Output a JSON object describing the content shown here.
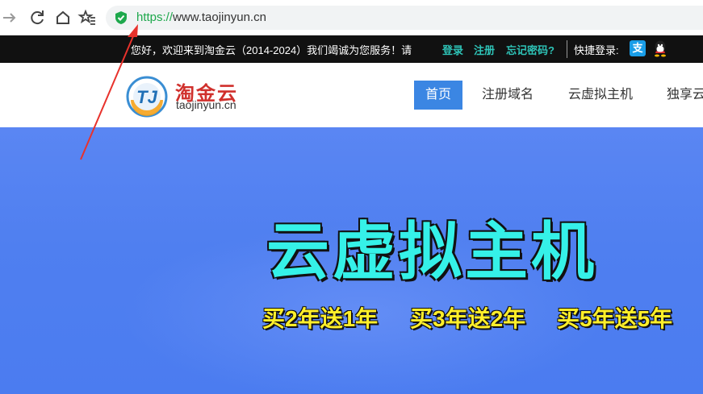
{
  "browser": {
    "url_scheme": "https://",
    "url_host": "www.taojinyun.cn",
    "icons": [
      "forward-icon",
      "reload-icon",
      "home-icon",
      "bookmark-star-icon",
      "secure-shield-icon"
    ]
  },
  "topbar": {
    "welcome": "您好，欢迎来到淘金云（2014-2024）我们竭诚为您服务！请",
    "login": "登录",
    "register": "注册",
    "forgot": "忘记密码?",
    "quick_login": "快捷登录:",
    "alipay_glyph": "支",
    "link_color": "#2ec3b7"
  },
  "header": {
    "logo_cn": "淘金云",
    "logo_en": "taojinyun.cn",
    "logo_mark": "TJ",
    "nav": [
      "首页",
      "注册域名",
      "云虚拟主机",
      "独享云"
    ],
    "active_color": "#3b86e3"
  },
  "banner": {
    "title": "云虚拟主机",
    "promos": [
      "买2年送1年",
      "买3年送2年",
      "买5年送5年"
    ],
    "title_color": "#35f1e8",
    "promo_color": "#ffef2a"
  },
  "annotation": {
    "color": "#e8322c"
  }
}
